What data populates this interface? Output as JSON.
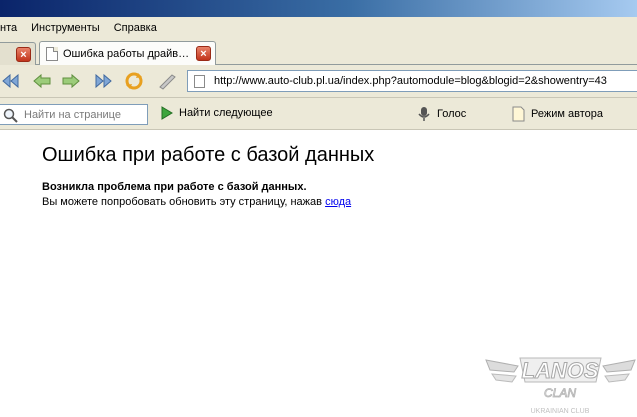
{
  "menu": [
    "нта",
    "Инструменты",
    "Справка"
  ],
  "tabs": [
    {
      "label": "",
      "active": false
    },
    {
      "label": "Ошибка работы драйв…",
      "active": true
    }
  ],
  "tab_close_glyph": "×",
  "address": {
    "url": "http://www.auto-club.pl.ua/index.php?automodule=blog&blogid=2&showentry=43"
  },
  "nav_icons": [
    "back-double-icon",
    "back-icon",
    "forward-icon",
    "forward-double-icon",
    "reload-icon",
    "edit-pen-icon"
  ],
  "findbar": {
    "placeholder": "Найти на странице",
    "find_next": "Найти следующее",
    "voice": "Голос",
    "author_mode": "Режим автора"
  },
  "page": {
    "title": "Ошибка при работе с базой данных",
    "subtitle": "Возникла проблема при работе с базой данных.",
    "line": "Вы можете попробовать обновить эту страницу, нажав",
    "link": "сюда"
  },
  "logo": {
    "text": "LANOS",
    "sub": "CLAN",
    "tag": "UKRAINIAN CLUB"
  },
  "colors": {
    "accent": "#0a246a",
    "chrome": "#ece9d8",
    "link": "#0000ee",
    "close": "#c1341b"
  }
}
